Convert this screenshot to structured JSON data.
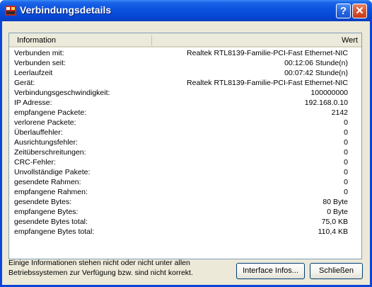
{
  "window": {
    "title": "Verbindungsdetails",
    "help_label": "?",
    "close_label": "✕"
  },
  "table": {
    "col_info": "Information",
    "col_value": "Wert",
    "rows": [
      {
        "label": "Verbunden mit:",
        "value": "Realtek RTL8139-Familie-PCI-Fast Ethernet-NIC"
      },
      {
        "label": "Verbunden seit:",
        "value": "00:12:06 Stunde(n)"
      },
      {
        "label": "Leerlaufzeit",
        "value": "00:07:42 Stunde(n)"
      },
      {
        "label": "Gerät:",
        "value": "Realtek RTL8139-Familie-PCI-Fast Ethernet-NIC"
      },
      {
        "label": "Verbindungsgeschwindigkeit:",
        "value": "100000000"
      },
      {
        "label": "IP Adresse:",
        "value": "192.168.0.10"
      },
      {
        "label": "empfangene Packete:",
        "value": "2142"
      },
      {
        "label": "verlorene Packete:",
        "value": "0"
      },
      {
        "label": "Überlauffehler:",
        "value": "0"
      },
      {
        "label": "Ausrichtungsfehler:",
        "value": "0"
      },
      {
        "label": "Zeitüberschreitungen:",
        "value": "0"
      },
      {
        "label": "CRC-Fehler:",
        "value": "0"
      },
      {
        "label": "Unvollständige Pakete:",
        "value": "0"
      },
      {
        "label": "gesendete Rahmen:",
        "value": "0"
      },
      {
        "label": "empfangene Rahmen:",
        "value": "0"
      },
      {
        "label": "gesendete Bytes:",
        "value": "80 Byte"
      },
      {
        "label": "empfangene Bytes:",
        "value": "0 Byte"
      },
      {
        "label": "gesendete Bytes total:",
        "value": "75,0 KB"
      },
      {
        "label": "empfangene Bytes total:",
        "value": "110,4 KB"
      }
    ]
  },
  "footer": {
    "note_line1": "Einige Informationen stehen nicht oder nicht unter allen",
    "note_line2": "Betriebssystemen zur Verfügung bzw. sind nicht korrekt.",
    "interface_button": "Interface Infos...",
    "close_button": "Schließen"
  }
}
